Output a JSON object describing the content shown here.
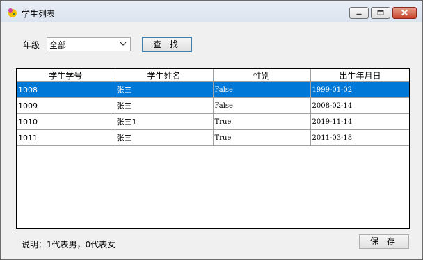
{
  "window": {
    "title": "学生列表",
    "icon": "app-icon"
  },
  "filter": {
    "grade_label": "年级",
    "grade_value": "全部",
    "search_button": "查 找"
  },
  "table": {
    "columns": [
      "学生学号",
      "学生姓名",
      "性别",
      "出生年月日"
    ],
    "rows": [
      [
        "1008",
        "张三",
        "False",
        "1999-01-02"
      ],
      [
        "1009",
        "张三",
        "False",
        "2008-02-14"
      ],
      [
        "1010",
        "张三1",
        "True",
        "2019-11-14"
      ],
      [
        "1011",
        "张三",
        "True",
        "2011-03-18"
      ]
    ],
    "selected_row_index": 0
  },
  "footer": {
    "note": "说明：1代表男，0代表女",
    "save_button": "保 存"
  },
  "colors": {
    "selection": "#0078d7",
    "title_bar": "#dbe4f0",
    "close_button": "#c9432b"
  }
}
